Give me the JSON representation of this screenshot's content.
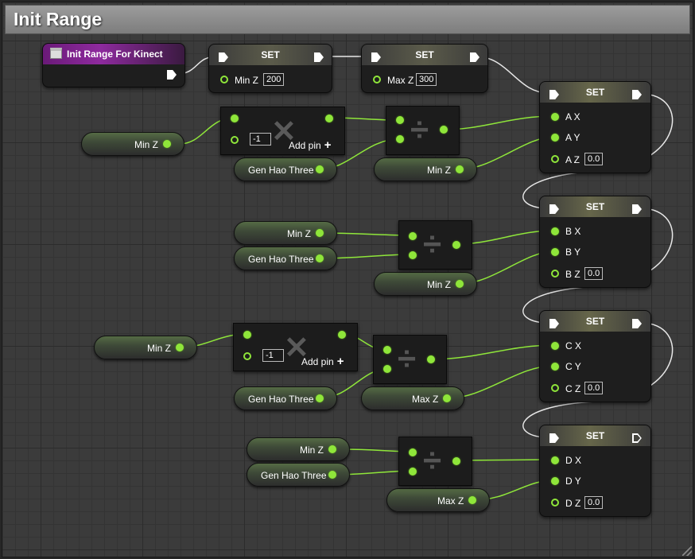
{
  "graph_title": "Init Range",
  "event": {
    "label": "Init Range For Kinect"
  },
  "set_title": "SET",
  "set_min": {
    "var": "Min Z",
    "value": "200"
  },
  "set_max": {
    "var": "Max Z",
    "value": "300"
  },
  "getters": {
    "min_z": "Min Z",
    "max_z": "Max Z",
    "gen_hao_three": "Gen Hao Three"
  },
  "multiply": {
    "const": "-1",
    "add_pin": "Add pin"
  },
  "set_nodes": [
    {
      "x": "A X",
      "y": "A Y",
      "z": "A Z",
      "z_value": "0.0"
    },
    {
      "x": "B X",
      "y": "B Y",
      "z": "B Z",
      "z_value": "0.0"
    },
    {
      "x": "C X",
      "y": "C Y",
      "z": "C Z",
      "z_value": "0.0"
    },
    {
      "x": "D X",
      "y": "D Y",
      "z": "D Z",
      "z_value": "0.0"
    }
  ],
  "colors": {
    "float_pin": "#8fe63a",
    "exec_wire": "#e8e8e8",
    "event_header": "#8e2a9e"
  },
  "icons": {
    "event": "event-icon",
    "multiply": "multiply-icon",
    "divide": "divide-icon"
  }
}
